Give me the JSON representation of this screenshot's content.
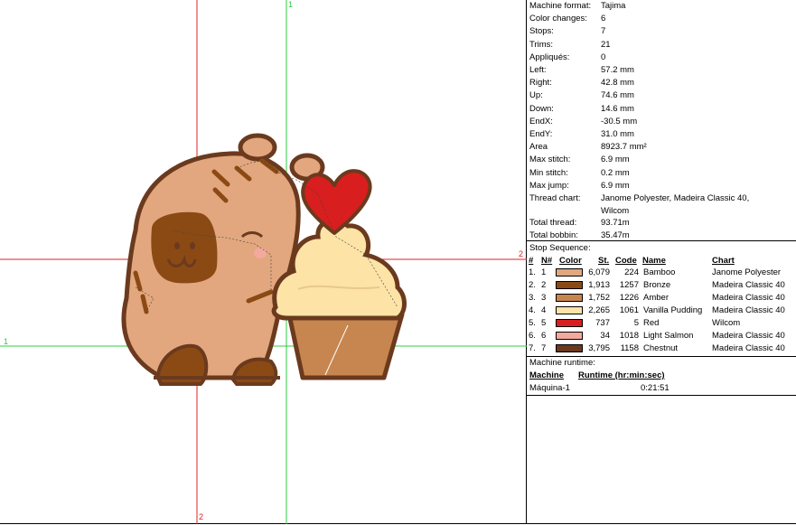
{
  "guides": {
    "v1_label": "1",
    "h1_label": "1",
    "v2_label": "2",
    "h2_label": "2"
  },
  "info": [
    {
      "k": "Machine format:",
      "v": "Tajima"
    },
    {
      "k": "Color changes:",
      "v": "6"
    },
    {
      "k": "Stops:",
      "v": "7"
    },
    {
      "k": "Trims:",
      "v": "21"
    },
    {
      "k": "Appliqués:",
      "v": "0"
    },
    {
      "k": "Left:",
      "v": "57.2 mm"
    },
    {
      "k": "Right:",
      "v": "42.8 mm"
    },
    {
      "k": "Up:",
      "v": "74.6 mm"
    },
    {
      "k": "Down:",
      "v": "14.6 mm"
    },
    {
      "k": "EndX:",
      "v": "-30.5 mm"
    },
    {
      "k": "EndY:",
      "v": "31.0 mm"
    },
    {
      "k": "Area",
      "v": "8923.7 mm²"
    },
    {
      "k": "Max stitch:",
      "v": "6.9 mm"
    },
    {
      "k": "Min stitch:",
      "v": "0.2 mm"
    },
    {
      "k": "Max jump:",
      "v": "6.9 mm"
    },
    {
      "k": "Thread chart:",
      "v": "Janome Polyester, Madeira Classic 40,",
      "v2": "Wilcom"
    },
    {
      "k": "Total thread:",
      "v": "93.71m"
    },
    {
      "k": "Total bobbin:",
      "v": "35.47m"
    }
  ],
  "stop_sequence": {
    "title": "Stop Sequence:",
    "headers": {
      "idx": "#",
      "n": "N#",
      "color": "Color",
      "st": "St.",
      "code": "Code",
      "name": "Name",
      "chart": "Chart"
    },
    "rows": [
      {
        "idx": "1.",
        "n": "1",
        "color": "#E2A77E",
        "st": "6,079",
        "code": "224",
        "name": "Bamboo",
        "chart": "Janome Polyester"
      },
      {
        "idx": "2.",
        "n": "2",
        "color": "#8B4A14",
        "st": "1,913",
        "code": "1257",
        "name": "Bronze",
        "chart": "Madeira Classic 40"
      },
      {
        "idx": "3.",
        "n": "3",
        "color": "#C7864F",
        "st": "1,752",
        "code": "1226",
        "name": "Amber",
        "chart": "Madeira Classic 40"
      },
      {
        "idx": "4.",
        "n": "4",
        "color": "#FDE3A6",
        "st": "2,265",
        "code": "1061",
        "name": "Vanilla Pudding",
        "chart": "Madeira Classic 40"
      },
      {
        "idx": "5.",
        "n": "5",
        "color": "#D81E1E",
        "st": "737",
        "code": "5",
        "name": "Red",
        "chart": "Wilcom"
      },
      {
        "idx": "6.",
        "n": "6",
        "color": "#F4A99E",
        "st": "34",
        "code": "1018",
        "name": "Light Salmon",
        "chart": "Madeira Classic 40"
      },
      {
        "idx": "7.",
        "n": "7",
        "color": "#6B3A1E",
        "st": "3,795",
        "code": "1158",
        "name": "Chestnut",
        "chart": "Madeira Classic 40"
      }
    ]
  },
  "runtime": {
    "title": "Machine runtime:",
    "headers": {
      "machine": "Machine",
      "runtime": "Runtime (hr:min:sec)"
    },
    "rows": [
      {
        "machine": "Máquina-1",
        "runtime": "0:21:51"
      }
    ]
  }
}
